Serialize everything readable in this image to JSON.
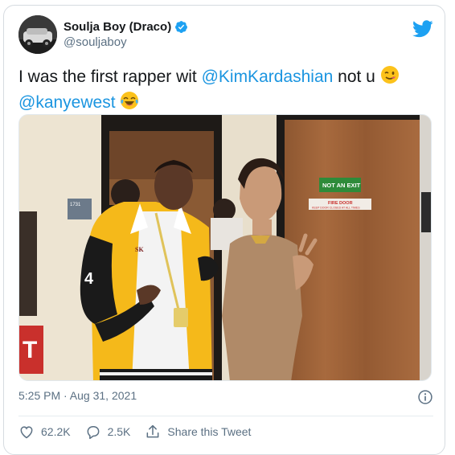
{
  "author": {
    "display_name": "Soulja Boy (Draco)",
    "handle": "@souljaboy",
    "verified": true
  },
  "tweet": {
    "text_part1": "I was the first rapper wit ",
    "mention1": "@KimKardashian",
    "text_part2": " not u ",
    "emoji1": "😉",
    "mention2": "@kanyewest",
    "emoji2": "😂"
  },
  "photo": {
    "sign_exit": "NOT AN EXIT",
    "sign_fire": "FIRE DOOR",
    "sign_fire_sub": "KEEP DOOR CLOSED AT ALL TIMES",
    "room_number": "1731",
    "jacket_letters": "SK"
  },
  "meta": {
    "timestamp": "5:25 PM · Aug 31, 2021"
  },
  "actions": {
    "likes": "62.2K",
    "replies": "2.5K",
    "share_label": "Share this Tweet"
  },
  "colors": {
    "accent": "#1da1f2",
    "mention": "#1b95e0",
    "text": "#14171a",
    "secondary": "#5b7083"
  },
  "icons": {
    "verified": "verified-badge-icon",
    "twitter": "twitter-bird-icon",
    "info": "info-icon",
    "like": "heart-icon",
    "reply": "speech-bubble-icon",
    "share": "share-upload-icon"
  }
}
